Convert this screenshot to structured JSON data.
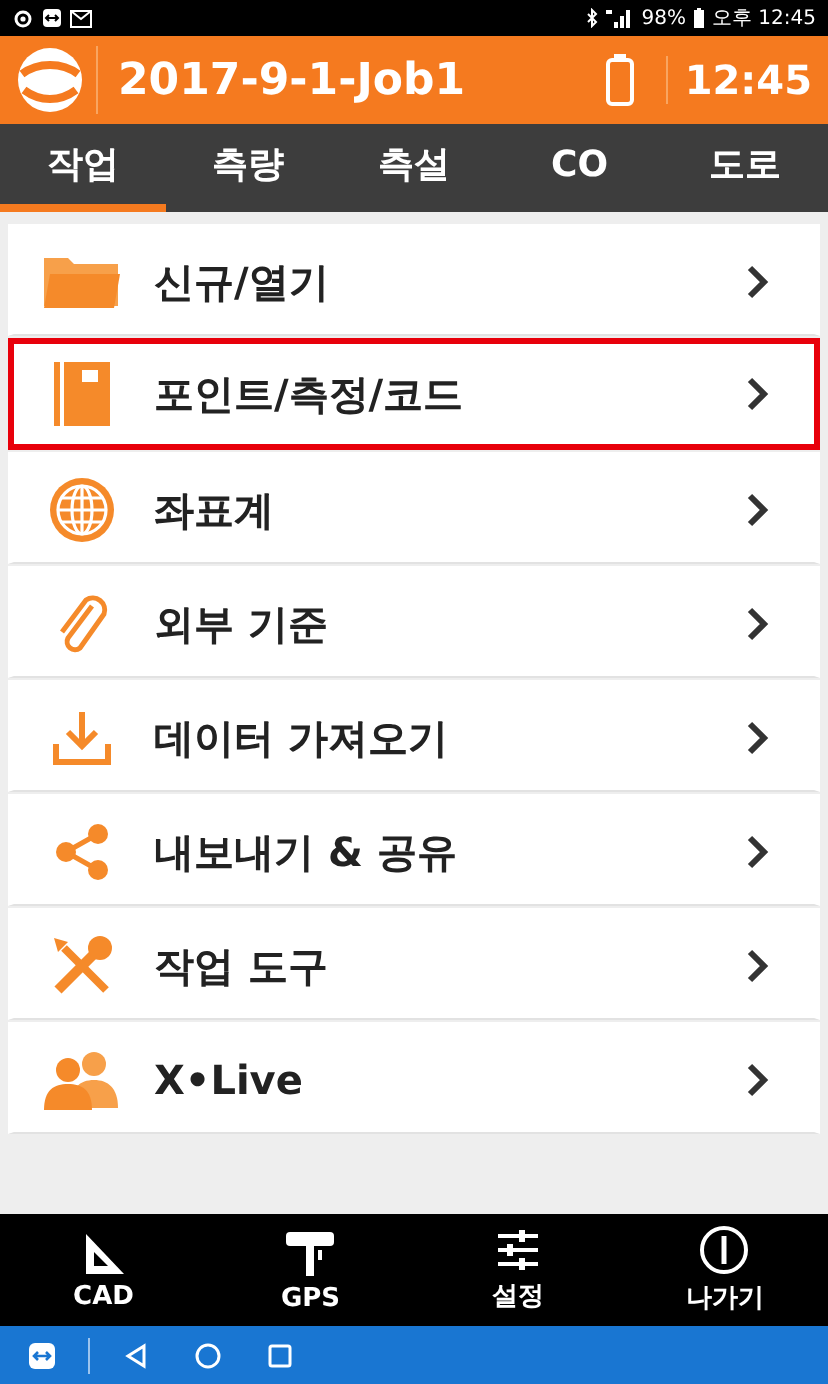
{
  "status_bar": {
    "battery": "98%",
    "time": "오후 12:45"
  },
  "header": {
    "title": "2017-9-1-Job1",
    "time": "12:45"
  },
  "tabs": [
    {
      "label": "작업",
      "selected": true
    },
    {
      "label": "측량",
      "selected": false
    },
    {
      "label": "측설",
      "selected": false
    },
    {
      "label": "CO",
      "selected": false
    },
    {
      "label": "도로",
      "selected": false
    }
  ],
  "menu": [
    {
      "label": "신규/열기",
      "kind": "folder",
      "highlighted": false
    },
    {
      "label": "포인트/측정/코드",
      "kind": "notebook",
      "highlighted": true
    },
    {
      "label": "좌표계",
      "kind": "globe",
      "highlighted": false
    },
    {
      "label": "외부 기준",
      "kind": "paperclip",
      "highlighted": false
    },
    {
      "label": "데이터 가져오기",
      "kind": "download",
      "highlighted": false
    },
    {
      "label": "내보내기 & 공유",
      "kind": "share",
      "highlighted": false
    },
    {
      "label": "작업 도구",
      "kind": "tools",
      "highlighted": false
    },
    {
      "label": "X•Live",
      "kind": "people",
      "highlighted": false
    }
  ],
  "bottom_bar": [
    {
      "label": "CAD",
      "kind": "triangle"
    },
    {
      "label": "GPS",
      "kind": "receiver"
    },
    {
      "label": "설정",
      "kind": "sliders"
    },
    {
      "label": "나가기",
      "kind": "power"
    }
  ]
}
